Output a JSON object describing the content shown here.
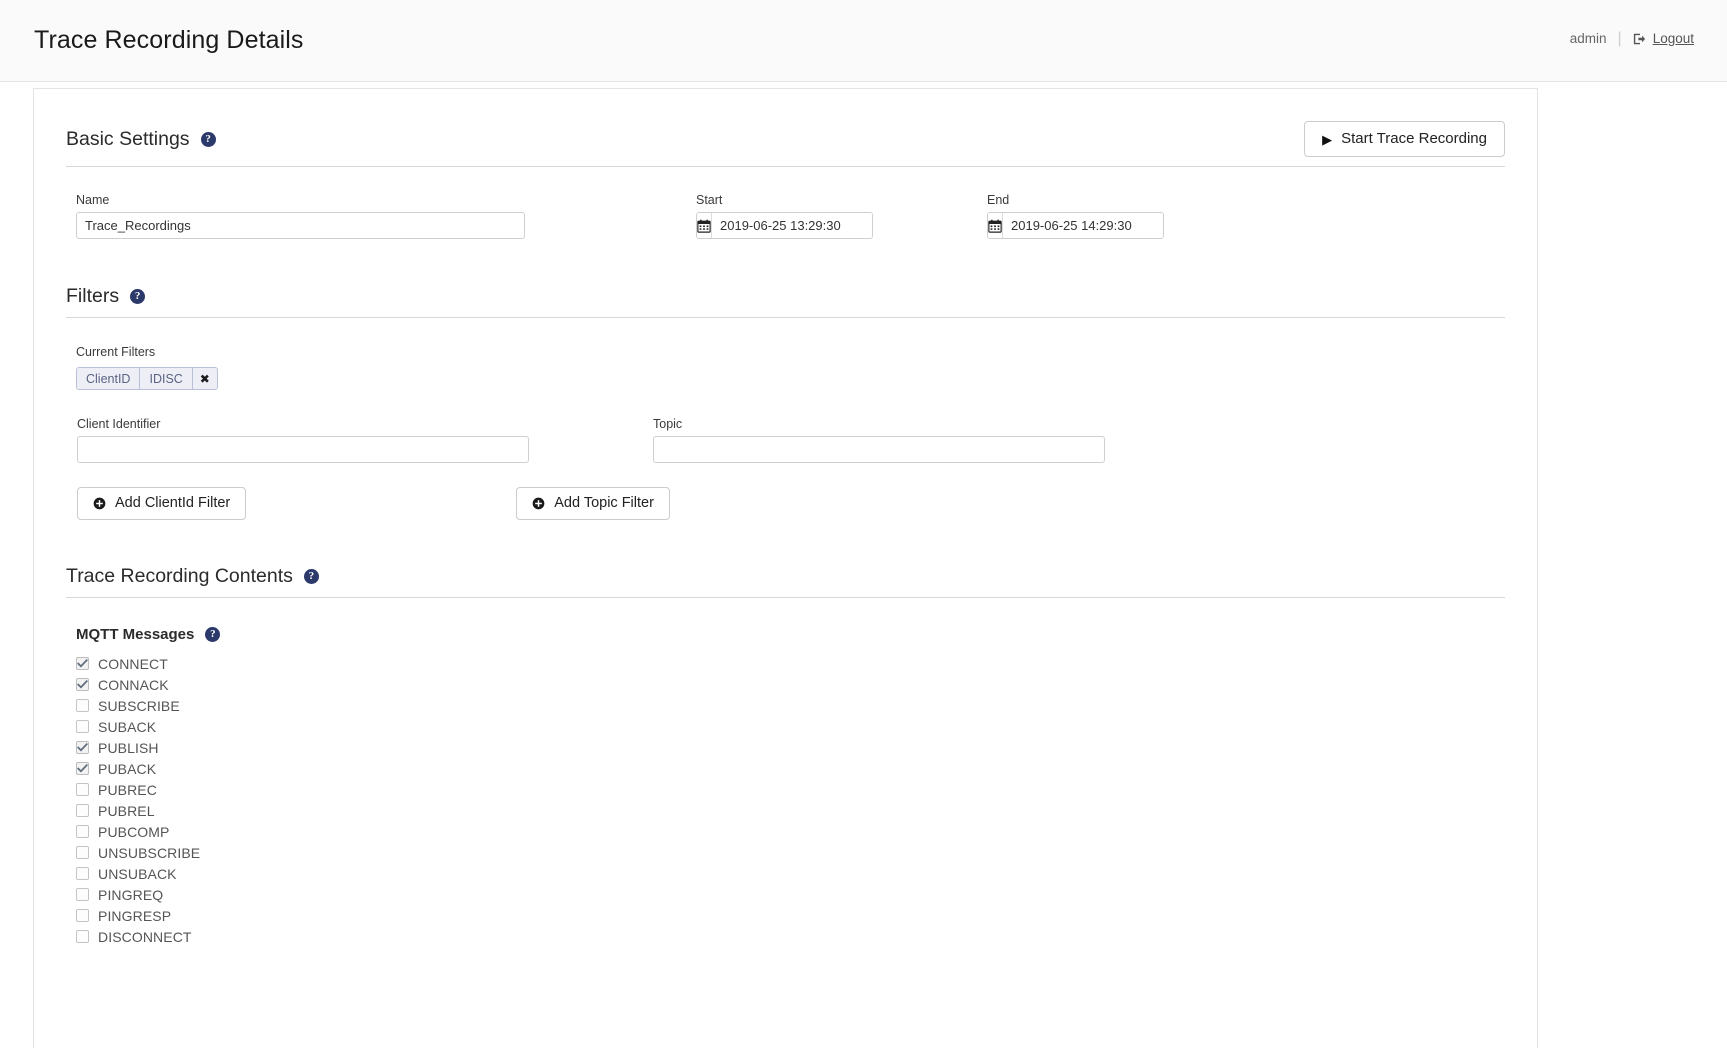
{
  "header": {
    "title": "Trace Recording Details",
    "user": "admin",
    "separator": "|",
    "logout_label": "Logout",
    "logout_icon": "sign-out-icon"
  },
  "basic_settings": {
    "title": "Basic Settings",
    "help_icon": "help-icon",
    "start_button": {
      "label": "Start Trace Recording",
      "icon": "play-icon"
    },
    "name": {
      "label": "Name",
      "value": "Trace_Recordings",
      "placeholder": ""
    },
    "start": {
      "label": "Start",
      "value": "2019-06-25 13:29:30",
      "icon": "calendar-icon"
    },
    "end": {
      "label": "End",
      "value": "2019-06-25 14:29:30",
      "icon": "calendar-icon"
    }
  },
  "filters": {
    "title": "Filters",
    "help_icon": "help-icon",
    "current_filters_label": "Current Filters",
    "chips": [
      {
        "type": "ClientID",
        "value": "IDISC",
        "remove_icon": "close-icon"
      }
    ],
    "client_identifier": {
      "label": "Client Identifier",
      "value": "",
      "placeholder": ""
    },
    "topic": {
      "label": "Topic",
      "value": "",
      "placeholder": ""
    },
    "add_client_button": {
      "label": "Add ClientId Filter",
      "icon": "plus-circle-icon"
    },
    "add_topic_button": {
      "label": "Add Topic Filter",
      "icon": "plus-circle-icon"
    }
  },
  "trace_contents": {
    "title": "Trace Recording Contents",
    "help_icon": "help-icon",
    "mqtt_messages": {
      "title": "MQTT Messages",
      "help_icon": "help-icon",
      "items": [
        {
          "label": "CONNECT",
          "checked": true
        },
        {
          "label": "CONNACK",
          "checked": true
        },
        {
          "label": "SUBSCRIBE",
          "checked": false
        },
        {
          "label": "SUBACK",
          "checked": false
        },
        {
          "label": "PUBLISH",
          "checked": true
        },
        {
          "label": "PUBACK",
          "checked": true
        },
        {
          "label": "PUBREC",
          "checked": false
        },
        {
          "label": "PUBREL",
          "checked": false
        },
        {
          "label": "PUBCOMP",
          "checked": false
        },
        {
          "label": "UNSUBSCRIBE",
          "checked": false
        },
        {
          "label": "UNSUBACK",
          "checked": false
        },
        {
          "label": "PINGREQ",
          "checked": false
        },
        {
          "label": "PINGRESP",
          "checked": false
        },
        {
          "label": "DISCONNECT",
          "checked": false
        }
      ]
    }
  },
  "colors": {
    "help_badge": "#2c3a6b",
    "chip_bg": "#eeeff6",
    "chip_border": "#b9c0d8",
    "chip_text": "#5a6382",
    "page_bg": "#ffffff",
    "topbar_bg": "#fafafa"
  }
}
